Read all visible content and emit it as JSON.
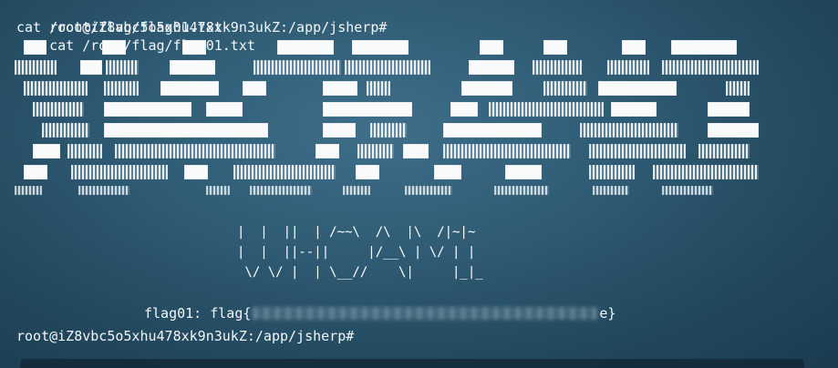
{
  "terminal": {
    "prompt": "root@iZ8vbc5o5xhu478xk9n3ukZ:/app/jsherp#",
    "command": "cat /root/flag/flag01.txt",
    "echo": "cat /root/flag/flag01.txt",
    "banner_lines": [
      "|  |  ||  | /~~\\  /\\  |\\  /|~|~",
      "|  |  ||--||     |/__\\ | \\/ | |",
      " \\/ \\/ |  | \\__//    \\|     |_|_"
    ],
    "flag_label": "flag01:",
    "flag_prefix": "flag{",
    "flag_suffix": "e}",
    "ascii_art_description": "block-letter ASCII art banner"
  },
  "colors": {
    "background": "#2f5b74",
    "text": "#f3f6f8"
  }
}
